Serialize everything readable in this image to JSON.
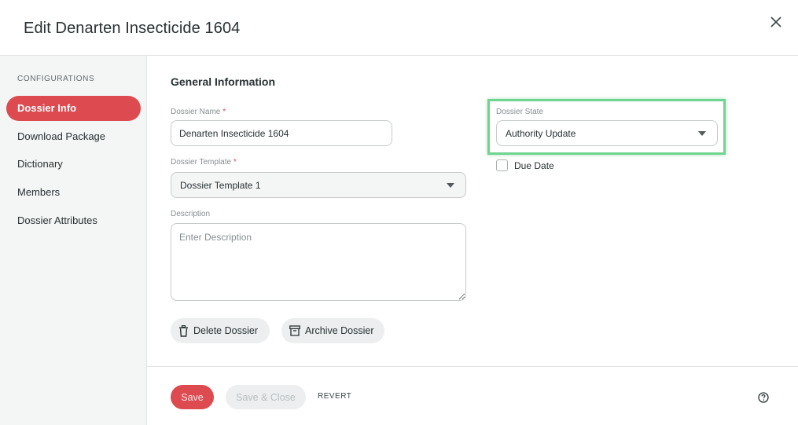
{
  "dialog": {
    "title": "Edit Denarten Insecticide 1604"
  },
  "sidebar": {
    "heading": "CONFIGURATIONS",
    "items": [
      {
        "label": "Dossier Info",
        "active": true
      },
      {
        "label": "Download Package",
        "active": false
      },
      {
        "label": "Dictionary",
        "active": false
      },
      {
        "label": "Members",
        "active": false
      },
      {
        "label": "Dossier Attributes",
        "active": false
      }
    ]
  },
  "form": {
    "section_title": "General Information",
    "dossier_name": {
      "label": "Dossier Name",
      "required_mark": "*",
      "value": "Denarten Insecticide 1604"
    },
    "dossier_template": {
      "label": "Dossier Template",
      "required_mark": "*",
      "value": "Dossier Template 1"
    },
    "description": {
      "label": "Description",
      "placeholder": "Enter Description",
      "value": ""
    },
    "dossier_state": {
      "label": "Dossier State",
      "value": "Authority Update"
    },
    "due_date": {
      "label": "Due Date",
      "checked": false
    },
    "delete_label": "Delete Dossier",
    "archive_label": "Archive Dossier"
  },
  "footer": {
    "save_label": "Save",
    "save_close_label": "Save & Close",
    "revert_label": "REVERT"
  },
  "icons": {
    "close": "close-icon",
    "trash": "trash-icon",
    "archive": "archive-icon",
    "dropdown": "chevron-down-icon",
    "help": "help-icon"
  },
  "colors": {
    "accent": "#dd4b50",
    "highlight": "#6fd48f",
    "sidebar_bg": "#f4f5f5"
  }
}
